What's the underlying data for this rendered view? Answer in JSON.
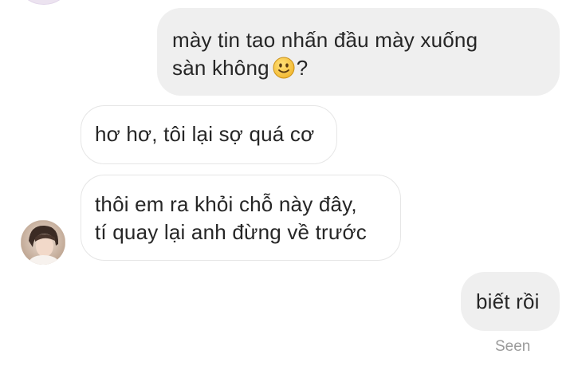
{
  "messages": [
    {
      "direction": "sent",
      "line1": "mày tin tao nhấn đầu mày xuống",
      "line2_before_emoji": "sàn không",
      "emoji": "slightly-smiling-face",
      "line2_after_emoji": "?"
    },
    {
      "direction": "received",
      "text": "hơ hơ, tôi lại sợ quá cơ"
    },
    {
      "direction": "received",
      "line1": "thôi em ra khỏi chỗ này đây,",
      "line2": "tí quay lại anh đừng về trước"
    },
    {
      "direction": "sent",
      "text": "biết rồi"
    }
  ],
  "status": {
    "seen_label": "Seen"
  },
  "colors": {
    "sent_bubble": "#efefef",
    "received_bubble_border": "#e6e6e6",
    "text": "#262626",
    "seen_text": "#9b9b9b",
    "emoji_face": "#f7c948"
  }
}
